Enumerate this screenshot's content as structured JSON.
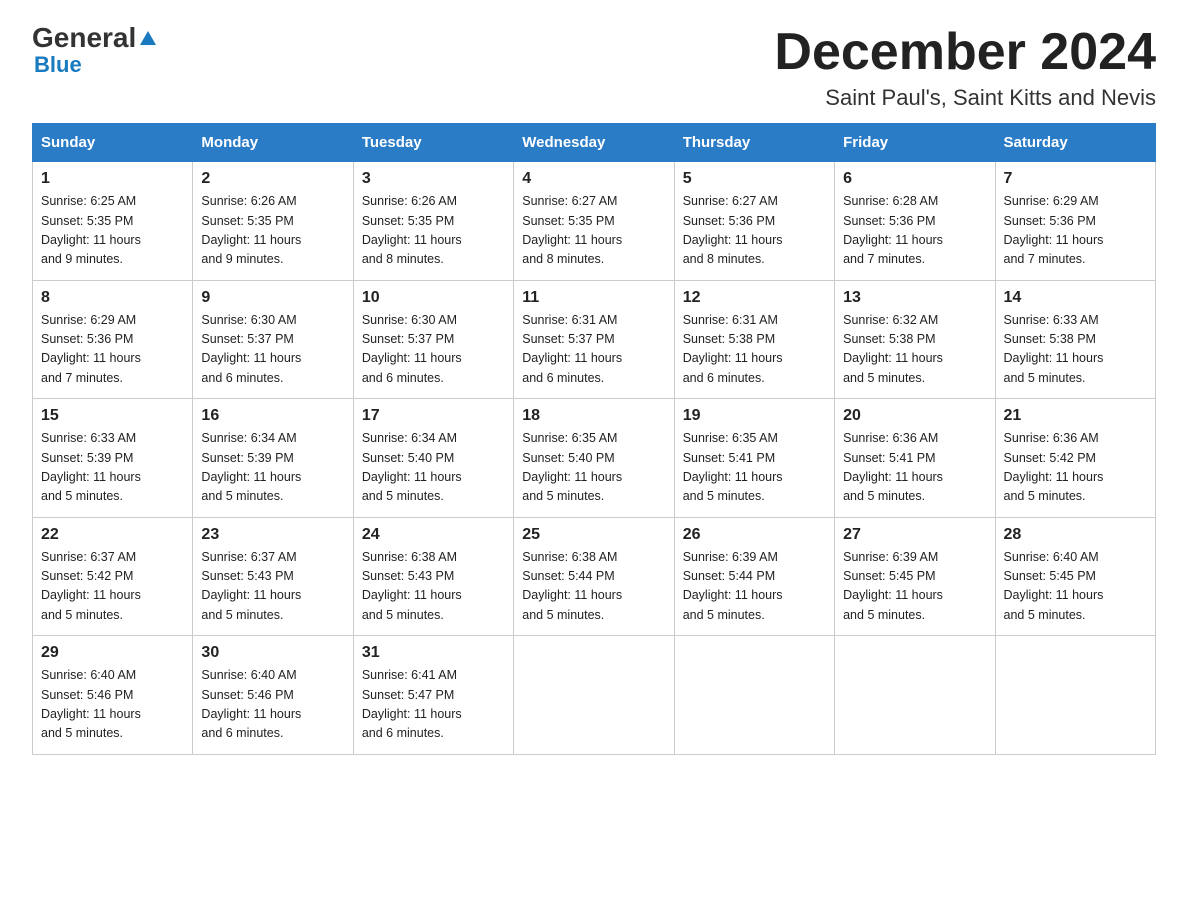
{
  "logo": {
    "general": "General",
    "blue": "Blue",
    "sub": "Blue"
  },
  "title": "December 2024",
  "location": "Saint Paul's, Saint Kitts and Nevis",
  "days_of_week": [
    "Sunday",
    "Monday",
    "Tuesday",
    "Wednesday",
    "Thursday",
    "Friday",
    "Saturday"
  ],
  "weeks": [
    [
      {
        "day": "1",
        "sunrise": "6:25 AM",
        "sunset": "5:35 PM",
        "daylight": "11 hours and 9 minutes."
      },
      {
        "day": "2",
        "sunrise": "6:26 AM",
        "sunset": "5:35 PM",
        "daylight": "11 hours and 9 minutes."
      },
      {
        "day": "3",
        "sunrise": "6:26 AM",
        "sunset": "5:35 PM",
        "daylight": "11 hours and 8 minutes."
      },
      {
        "day": "4",
        "sunrise": "6:27 AM",
        "sunset": "5:35 PM",
        "daylight": "11 hours and 8 minutes."
      },
      {
        "day": "5",
        "sunrise": "6:27 AM",
        "sunset": "5:36 PM",
        "daylight": "11 hours and 8 minutes."
      },
      {
        "day": "6",
        "sunrise": "6:28 AM",
        "sunset": "5:36 PM",
        "daylight": "11 hours and 7 minutes."
      },
      {
        "day": "7",
        "sunrise": "6:29 AM",
        "sunset": "5:36 PM",
        "daylight": "11 hours and 7 minutes."
      }
    ],
    [
      {
        "day": "8",
        "sunrise": "6:29 AM",
        "sunset": "5:36 PM",
        "daylight": "11 hours and 7 minutes."
      },
      {
        "day": "9",
        "sunrise": "6:30 AM",
        "sunset": "5:37 PM",
        "daylight": "11 hours and 6 minutes."
      },
      {
        "day": "10",
        "sunrise": "6:30 AM",
        "sunset": "5:37 PM",
        "daylight": "11 hours and 6 minutes."
      },
      {
        "day": "11",
        "sunrise": "6:31 AM",
        "sunset": "5:37 PM",
        "daylight": "11 hours and 6 minutes."
      },
      {
        "day": "12",
        "sunrise": "6:31 AM",
        "sunset": "5:38 PM",
        "daylight": "11 hours and 6 minutes."
      },
      {
        "day": "13",
        "sunrise": "6:32 AM",
        "sunset": "5:38 PM",
        "daylight": "11 hours and 5 minutes."
      },
      {
        "day": "14",
        "sunrise": "6:33 AM",
        "sunset": "5:38 PM",
        "daylight": "11 hours and 5 minutes."
      }
    ],
    [
      {
        "day": "15",
        "sunrise": "6:33 AM",
        "sunset": "5:39 PM",
        "daylight": "11 hours and 5 minutes."
      },
      {
        "day": "16",
        "sunrise": "6:34 AM",
        "sunset": "5:39 PM",
        "daylight": "11 hours and 5 minutes."
      },
      {
        "day": "17",
        "sunrise": "6:34 AM",
        "sunset": "5:40 PM",
        "daylight": "11 hours and 5 minutes."
      },
      {
        "day": "18",
        "sunrise": "6:35 AM",
        "sunset": "5:40 PM",
        "daylight": "11 hours and 5 minutes."
      },
      {
        "day": "19",
        "sunrise": "6:35 AM",
        "sunset": "5:41 PM",
        "daylight": "11 hours and 5 minutes."
      },
      {
        "day": "20",
        "sunrise": "6:36 AM",
        "sunset": "5:41 PM",
        "daylight": "11 hours and 5 minutes."
      },
      {
        "day": "21",
        "sunrise": "6:36 AM",
        "sunset": "5:42 PM",
        "daylight": "11 hours and 5 minutes."
      }
    ],
    [
      {
        "day": "22",
        "sunrise": "6:37 AM",
        "sunset": "5:42 PM",
        "daylight": "11 hours and 5 minutes."
      },
      {
        "day": "23",
        "sunrise": "6:37 AM",
        "sunset": "5:43 PM",
        "daylight": "11 hours and 5 minutes."
      },
      {
        "day": "24",
        "sunrise": "6:38 AM",
        "sunset": "5:43 PM",
        "daylight": "11 hours and 5 minutes."
      },
      {
        "day": "25",
        "sunrise": "6:38 AM",
        "sunset": "5:44 PM",
        "daylight": "11 hours and 5 minutes."
      },
      {
        "day": "26",
        "sunrise": "6:39 AM",
        "sunset": "5:44 PM",
        "daylight": "11 hours and 5 minutes."
      },
      {
        "day": "27",
        "sunrise": "6:39 AM",
        "sunset": "5:45 PM",
        "daylight": "11 hours and 5 minutes."
      },
      {
        "day": "28",
        "sunrise": "6:40 AM",
        "sunset": "5:45 PM",
        "daylight": "11 hours and 5 minutes."
      }
    ],
    [
      {
        "day": "29",
        "sunrise": "6:40 AM",
        "sunset": "5:46 PM",
        "daylight": "11 hours and 5 minutes."
      },
      {
        "day": "30",
        "sunrise": "6:40 AM",
        "sunset": "5:46 PM",
        "daylight": "11 hours and 6 minutes."
      },
      {
        "day": "31",
        "sunrise": "6:41 AM",
        "sunset": "5:47 PM",
        "daylight": "11 hours and 6 minutes."
      },
      null,
      null,
      null,
      null
    ]
  ],
  "labels": {
    "sunrise": "Sunrise:",
    "sunset": "Sunset:",
    "daylight": "Daylight:"
  }
}
